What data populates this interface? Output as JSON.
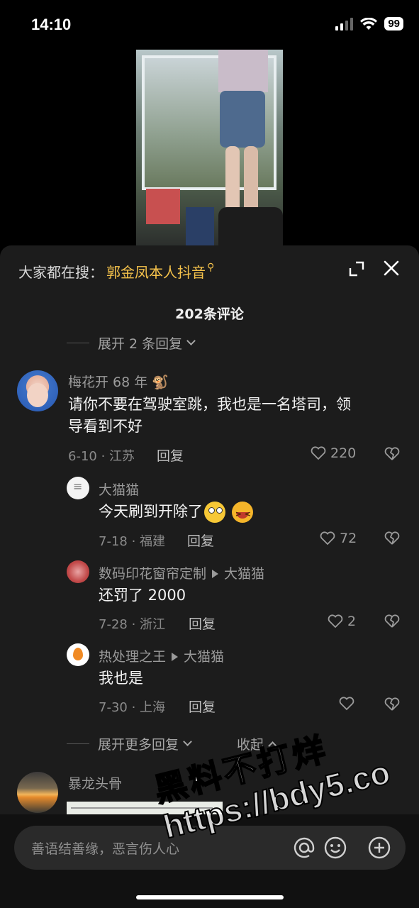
{
  "status_bar": {
    "time": "14:10",
    "battery": "99"
  },
  "sheet": {
    "search_prefix": "大家都在搜：",
    "search_term": "郭金凤本人抖音",
    "comment_count": "202条评论",
    "expand_replies_top": "展开 2 条回复",
    "comments": [
      {
        "name": "梅花开 68 年 🐒",
        "text_line1": "请你不要在驾驶室跳，我也是一名塔司，领",
        "text_line2": "导看到不好",
        "meta": "6-10 · 江苏",
        "reply": "回复",
        "likes": "220",
        "replies": [
          {
            "name": "大猫猫",
            "text": "今天刷到开除了",
            "meta": "7-18 · 福建",
            "reply": "回复",
            "likes": "72"
          },
          {
            "name": "数码印花窗帘定制",
            "reply_to": "大猫猫",
            "text": "还罚了 2000",
            "meta": "7-28 · 浙江",
            "reply": "回复",
            "likes": "2"
          },
          {
            "name": "热处理之王",
            "reply_to": "大猫猫",
            "text": "我也是",
            "meta": "7-30 · 上海",
            "reply": "回复",
            "likes": ""
          }
        ]
      },
      {
        "name": "暴龙头骨"
      }
    ],
    "expand_more": "展开更多回复",
    "collapse": "收起"
  },
  "input": {
    "placeholder": "善语结善缘，恶言伤人心"
  },
  "watermark": {
    "line1": "黑料不打烊",
    "line2": "https://bdy5.co"
  },
  "colors": {
    "accent": "#f5c24b",
    "sheet_bg": "#1c1c1c"
  }
}
